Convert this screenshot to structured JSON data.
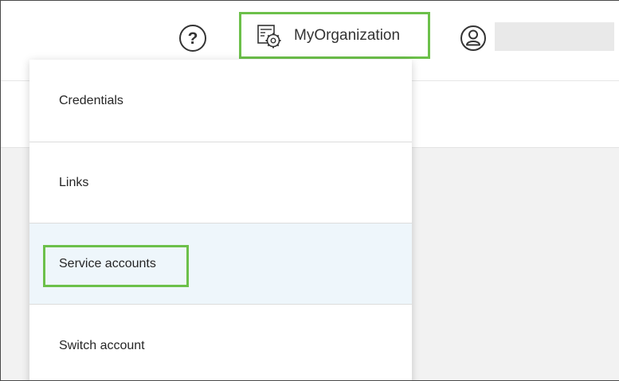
{
  "header": {
    "help_glyph": "?",
    "org_name": "MyOrganization",
    "user_name": ""
  },
  "menu": {
    "items": [
      {
        "label": "Credentials"
      },
      {
        "label": "Links"
      },
      {
        "label": "Service accounts",
        "highlighted": true
      },
      {
        "label": "Switch account"
      }
    ]
  },
  "colors": {
    "highlight": "#6cc04a",
    "hover_bg": "#eef6fb",
    "icon": "#333333"
  },
  "icons": {
    "help": "help-circle-icon",
    "org": "organization-settings-icon",
    "user": "user-avatar-icon"
  }
}
